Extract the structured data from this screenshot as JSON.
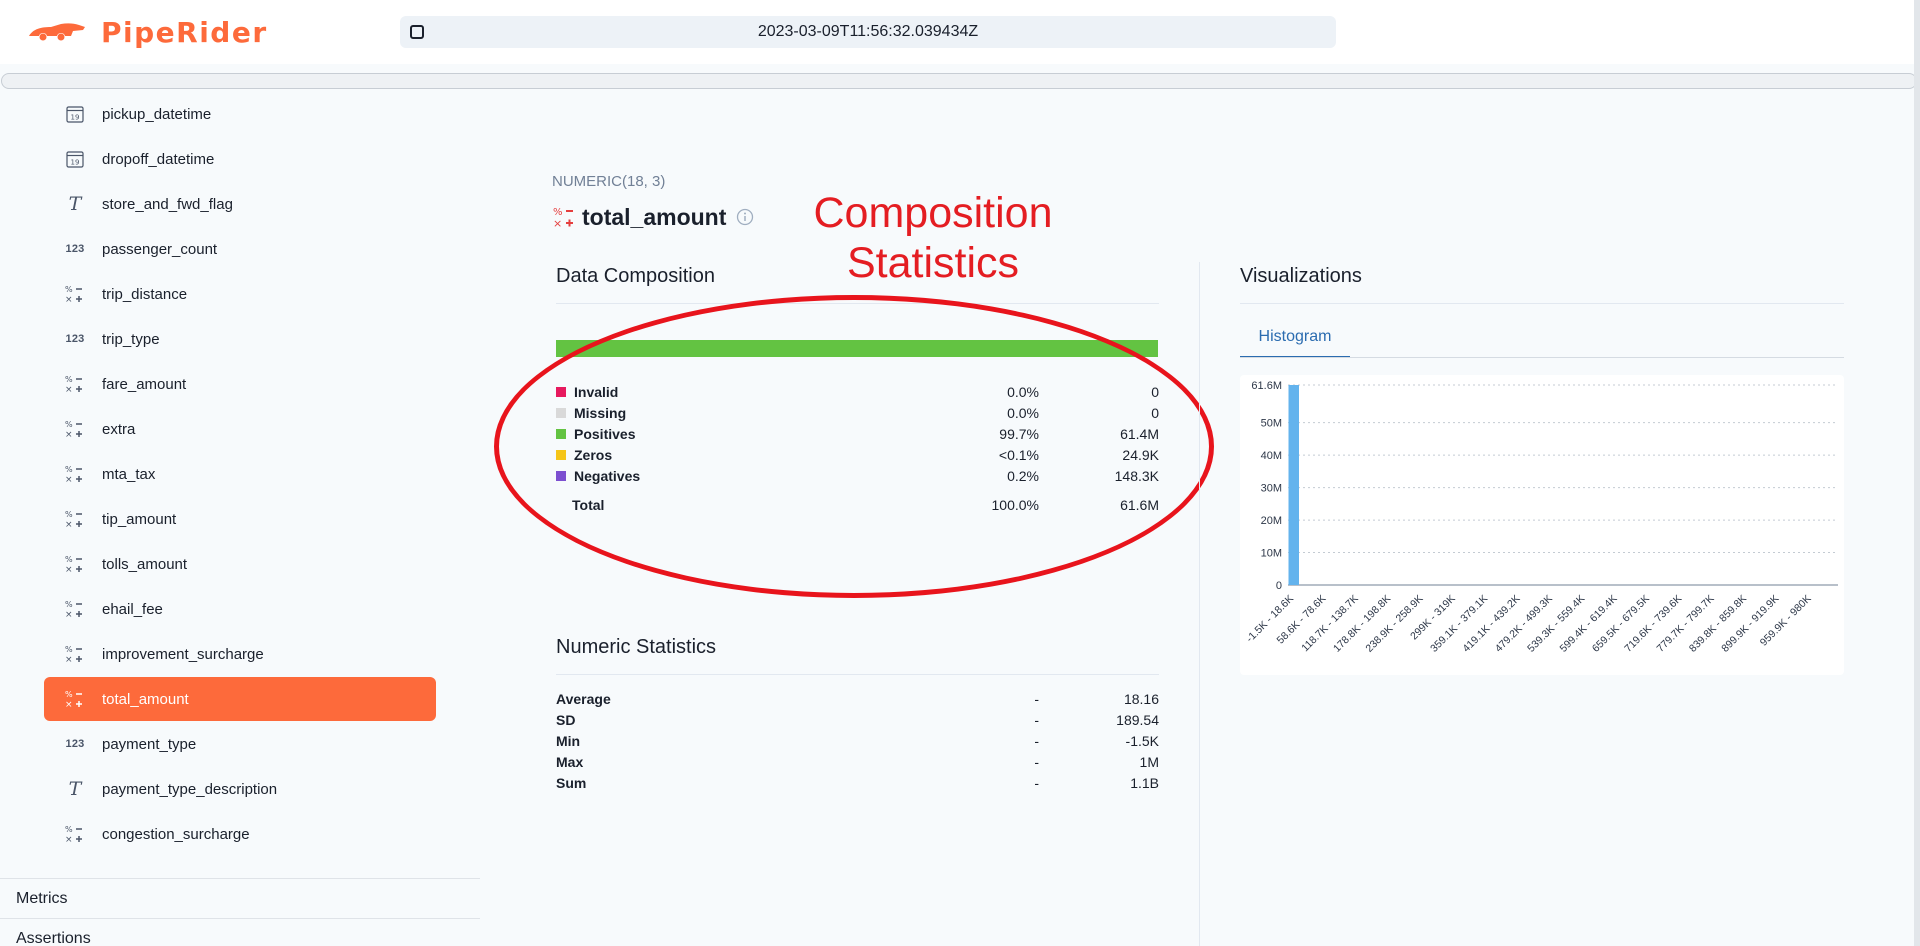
{
  "app": {
    "name": "PipeRider",
    "timestamp": "2023-03-09T11:56:32.039434Z"
  },
  "sidebar": {
    "columns": [
      {
        "label": "pickup_datetime",
        "icon": "calendar-icon"
      },
      {
        "label": "dropoff_datetime",
        "icon": "calendar-icon"
      },
      {
        "label": "store_and_fwd_flag",
        "icon": "text-type-icon"
      },
      {
        "label": "passenger_count",
        "icon": "integer-type-icon"
      },
      {
        "label": "trip_distance",
        "icon": "numeric-type-icon"
      },
      {
        "label": "trip_type",
        "icon": "integer-type-icon"
      },
      {
        "label": "fare_amount",
        "icon": "numeric-type-icon"
      },
      {
        "label": "extra",
        "icon": "numeric-type-icon"
      },
      {
        "label": "mta_tax",
        "icon": "numeric-type-icon"
      },
      {
        "label": "tip_amount",
        "icon": "numeric-type-icon"
      },
      {
        "label": "tolls_amount",
        "icon": "numeric-type-icon"
      },
      {
        "label": "ehail_fee",
        "icon": "numeric-type-icon"
      },
      {
        "label": "improvement_surcharge",
        "icon": "numeric-type-icon"
      },
      {
        "label": "total_amount",
        "icon": "numeric-type-icon",
        "active": true
      },
      {
        "label": "payment_type",
        "icon": "integer-type-icon"
      },
      {
        "label": "payment_type_description",
        "icon": "text-type-icon"
      },
      {
        "label": "congestion_surcharge",
        "icon": "numeric-type-icon"
      }
    ],
    "integer_icon_text": "123",
    "text_icon_text": "T",
    "calendar_icon_text": "19",
    "metrics_label": "Metrics",
    "assertions_label": "Assertions"
  },
  "column": {
    "type": "NUMERIC(18, 3)",
    "name": "total_amount"
  },
  "annotation": {
    "line1": "Composition",
    "line2": "Statistics"
  },
  "composition": {
    "title": "Data Composition",
    "rows": [
      {
        "label": "Invalid",
        "pct": "0.0%",
        "value": "0",
        "color": "#e6195e"
      },
      {
        "label": "Missing",
        "pct": "0.0%",
        "value": "0",
        "color": "#d9d9d9"
      },
      {
        "label": "Positives",
        "pct": "99.7%",
        "value": "61.4M",
        "color": "#63c342"
      },
      {
        "label": "Zeros",
        "pct": "<0.1%",
        "value": "24.9K",
        "color": "#f5c518"
      },
      {
        "label": "Negatives",
        "pct": "0.2%",
        "value": "148.3K",
        "color": "#7c4fd0"
      }
    ],
    "total": {
      "label": "Total",
      "pct": "100.0%",
      "value": "61.6M"
    },
    "bar_fraction": 0.997
  },
  "numeric": {
    "title": "Numeric Statistics",
    "rows": [
      {
        "label": "Average",
        "pct": "-",
        "value": "18.16"
      },
      {
        "label": "SD",
        "pct": "-",
        "value": "189.54"
      },
      {
        "label": "Min",
        "pct": "-",
        "value": "-1.5K"
      },
      {
        "label": "Max",
        "pct": "-",
        "value": "1M"
      },
      {
        "label": "Sum",
        "pct": "-",
        "value": "1.1B"
      }
    ]
  },
  "visualizations": {
    "title": "Visualizations",
    "tab": "Histogram"
  },
  "chart_data": {
    "type": "bar",
    "categories": [
      "-1.5K - 18.6K",
      "58.6K - 78.6K",
      "118.7K - 138.7K",
      "178.8K - 198.8K",
      "238.9K - 258.9K",
      "299K - 319K",
      "359.1K - 379.1K",
      "419.1K - 439.2K",
      "479.2K - 499.3K",
      "539.3K - 559.4K",
      "599.4K - 619.4K",
      "659.5K - 679.5K",
      "719.6K - 739.6K",
      "779.7K - 799.7K",
      "839.8K - 859.8K",
      "899.9K - 919.9K",
      "959.9K - 980K"
    ],
    "values": [
      61600000,
      0,
      0,
      0,
      0,
      0,
      0,
      0,
      0,
      0,
      0,
      0,
      0,
      0,
      0,
      0,
      0
    ],
    "ytick_labels": [
      "0",
      "10M",
      "20M",
      "30M",
      "40M",
      "50M",
      "61.6M"
    ],
    "ytick_values": [
      0,
      10000000,
      20000000,
      30000000,
      40000000,
      50000000,
      61600000
    ],
    "ylim": [
      0,
      61600000
    ],
    "bar_color": "#63b3ed",
    "grid": true
  }
}
